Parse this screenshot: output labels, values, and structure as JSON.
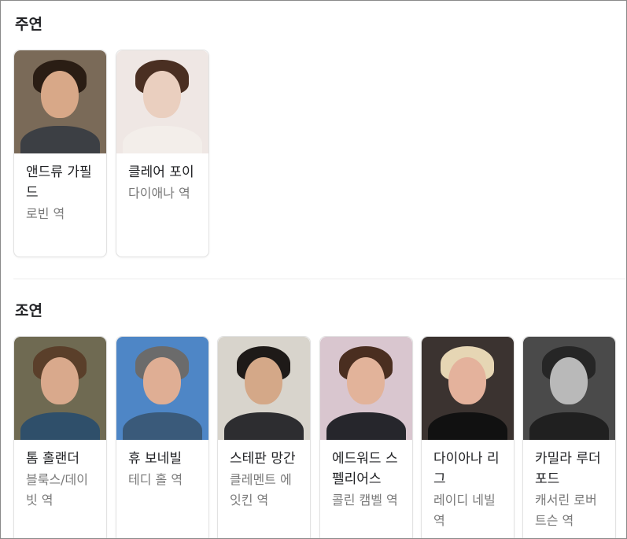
{
  "sections": {
    "main": {
      "title": "주연",
      "cast": [
        {
          "name": "앤드류 가필드",
          "role": "로빈 역",
          "bg": "#7a6a58",
          "hair": "#2a1d14",
          "skin": "#d8a888",
          "clothes": "#3c3f44"
        },
        {
          "name": "클레어 포이",
          "role": "다이애나 역",
          "bg": "#efe7e4",
          "hair": "#4a2f22",
          "skin": "#eacfbf",
          "clothes": "#f3eeea"
        }
      ]
    },
    "supporting": {
      "title": "조연",
      "cast": [
        {
          "name": "톰 홀랜더",
          "role": "블룩스/데이빗 역",
          "bg": "#6f6a52",
          "hair": "#5a3f2a",
          "skin": "#d9a98c",
          "clothes": "#2f4f6a"
        },
        {
          "name": "휴 보네빌",
          "role": "테디 홀 역",
          "bg": "#4e86c6",
          "hair": "#6b6b6b",
          "skin": "#dfae94",
          "clothes": "#3a5a7a"
        },
        {
          "name": "스테판 망간",
          "role": "클레멘트 에잇킨 역",
          "bg": "#d8d4cc",
          "hair": "#1e1a18",
          "skin": "#d4a888",
          "clothes": "#2d2d30"
        },
        {
          "name": "에드워드 스펠리어스",
          "role": "콜린 캠벨 역",
          "bg": "#d9c6cf",
          "hair": "#4a2e20",
          "skin": "#e2b39a",
          "clothes": "#26262c"
        },
        {
          "name": "다이아나 리그",
          "role": "레이디 네빌 역",
          "bg": "#3b3330",
          "hair": "#e6d6b4",
          "skin": "#e4b29c",
          "clothes": "#111111"
        },
        {
          "name": "카밀라 루더포드",
          "role": "캐서린 로버트슨 역",
          "bg": "#4a4a4a",
          "hair": "#262626",
          "skin": "#b9b9b9",
          "clothes": "#202020"
        }
      ]
    }
  }
}
